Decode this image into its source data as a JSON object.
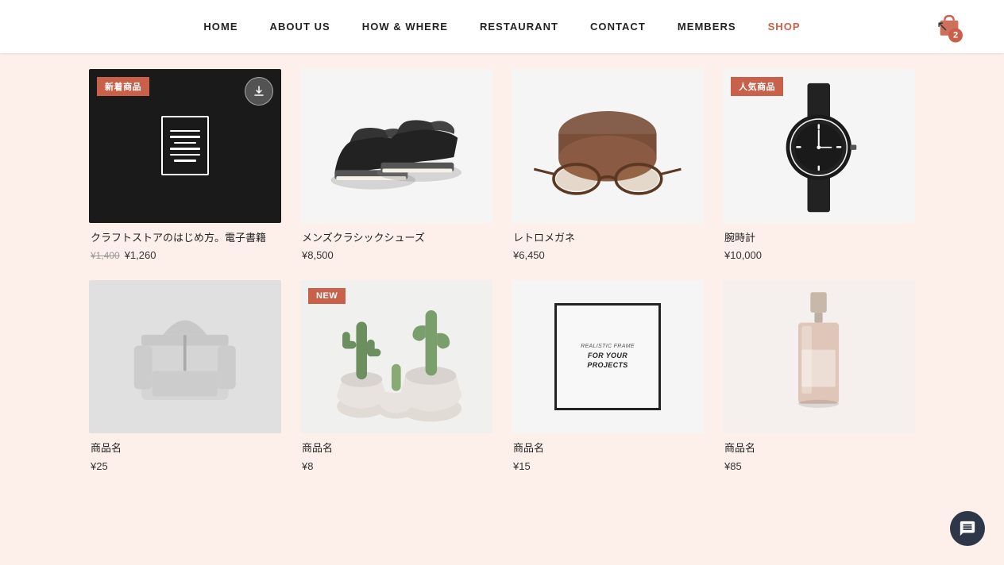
{
  "navbar": {
    "links": [
      {
        "label": "HOME",
        "href": "#",
        "active": false
      },
      {
        "label": "ABOUT US",
        "href": "#",
        "active": false
      },
      {
        "label": "HOW & WHERE",
        "href": "#",
        "active": false
      },
      {
        "label": "RESTAURANT",
        "href": "#",
        "active": false
      },
      {
        "label": "CONTACT",
        "href": "#",
        "active": false
      },
      {
        "label": "MEMBERS",
        "href": "#",
        "active": false
      },
      {
        "label": "SHOP",
        "href": "#",
        "active": true
      }
    ],
    "cart_count": "2"
  },
  "products": [
    {
      "id": 1,
      "badge": "新着商品",
      "badge_color": "#c9614a",
      "has_download": true,
      "image_type": "ebook",
      "bg_color": "#1a1a1a",
      "name": "クラフトストアのはじめ方。電子書籍",
      "price_original": "¥1,400",
      "price_sale": "¥1,260",
      "price_regular": null
    },
    {
      "id": 2,
      "badge": null,
      "has_download": false,
      "image_type": "shoes",
      "bg_color": "#f5f5f5",
      "name": "メンズクラシックシューズ",
      "price_original": null,
      "price_sale": null,
      "price_regular": "¥8,500"
    },
    {
      "id": 3,
      "badge": null,
      "has_download": false,
      "image_type": "glasses",
      "bg_color": "#f5f5f5",
      "name": "レトロメガネ",
      "price_original": null,
      "price_sale": null,
      "price_regular": "¥6,450"
    },
    {
      "id": 4,
      "badge": "人気商品",
      "badge_color": "#c9614a",
      "has_download": false,
      "image_type": "watch",
      "bg_color": "#f5f5f5",
      "name": "腕時計",
      "price_original": null,
      "price_sale": null,
      "price_regular": "¥10,000"
    },
    {
      "id": 5,
      "badge": null,
      "has_download": false,
      "image_type": "hoodie",
      "bg_color": "#e8e8e8",
      "name": "商品名",
      "price_original": null,
      "price_sale": null,
      "price_regular": "¥25"
    },
    {
      "id": 6,
      "badge": "NEW",
      "badge_color": "#c9614a",
      "has_download": false,
      "image_type": "cactus",
      "bg_color": "#f0f0ee",
      "name": "商品名",
      "price_original": null,
      "price_sale": null,
      "price_regular": "¥8"
    },
    {
      "id": 7,
      "badge": null,
      "has_download": false,
      "image_type": "frame",
      "bg_color": "#f5f5f5",
      "name": "商品名",
      "price_original": null,
      "price_sale": null,
      "price_regular": "¥15"
    },
    {
      "id": 8,
      "badge": null,
      "has_download": false,
      "image_type": "perfume",
      "bg_color": "#f5f0ee",
      "name": "商品名",
      "price_original": null,
      "price_sale": null,
      "price_regular": "¥85"
    }
  ],
  "frame_text_line1": "REALISTIC FRAME",
  "frame_text_line2": "FOR YOUR",
  "frame_text_line3": "PROJECTS",
  "chat_label": "chat"
}
